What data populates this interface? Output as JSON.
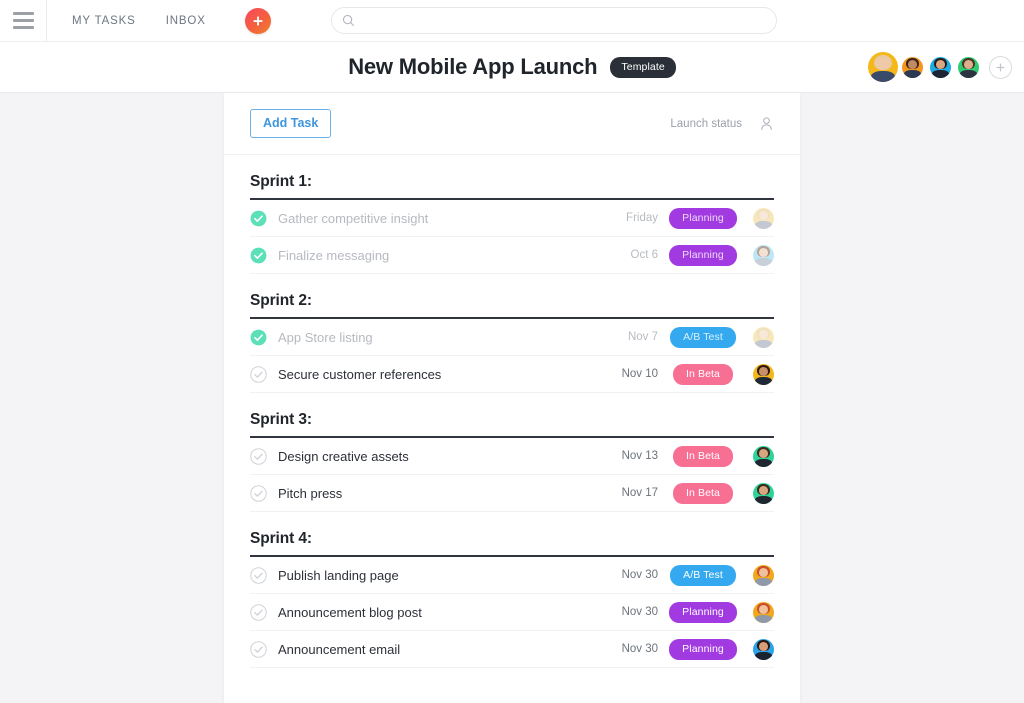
{
  "topnav": {
    "menu_icon": "hamburger-icon",
    "links": [
      {
        "label": "MY TASKS"
      },
      {
        "label": "INBOX"
      }
    ],
    "create_button_icon": "plus-icon",
    "search": {
      "icon": "search-icon",
      "value": "",
      "placeholder": ""
    }
  },
  "project_header": {
    "title": "New Mobile App Launch",
    "badge": "Template",
    "add_member_icon": "plus-icon",
    "members": [
      {
        "name": "member-1",
        "bg": "#f5b81a",
        "hair": "#e8c9a0",
        "skin": "#f0c9a8",
        "body": "#3a4a6b"
      },
      {
        "name": "member-2",
        "bg": "#f3961d",
        "hair": "#3b2419",
        "skin": "#c08a62",
        "body": "#2b3a52"
      },
      {
        "name": "member-3",
        "bg": "#1cabe3",
        "hair": "#2b1a14",
        "skin": "#d8a882",
        "body": "#1c2433"
      },
      {
        "name": "member-4",
        "bg": "#2ecb73",
        "hair": "#4a3527",
        "skin": "#dcae8c",
        "body": "#2d3440"
      }
    ]
  },
  "board": {
    "add_task_label": "Add Task",
    "launch_status_label": "Launch status",
    "assignee_header_icon": "person-icon",
    "sections": [
      {
        "title": "Sprint 1:",
        "tasks": [
          {
            "name": "Gather competitive insight",
            "date": "Friday",
            "tag": "Planning",
            "tag_color": "purple",
            "done": true,
            "avatar": {
              "bg": "#f1d27a",
              "hair": "#e5c27e",
              "skin": "#f3d2b6",
              "body": "#8892a8"
            }
          },
          {
            "name": "Finalize messaging",
            "date": "Oct 6",
            "tag": "Planning",
            "tag_color": "purple",
            "done": true,
            "avatar": {
              "bg": "#7fd0ef",
              "hair": "#6b4a38",
              "skin": "#e8c4a4",
              "body": "#93a0b5"
            }
          }
        ]
      },
      {
        "title": "Sprint 2:",
        "tasks": [
          {
            "name": "App Store listing",
            "date": "Nov 7",
            "tag": "A/B Test",
            "tag_color": "blue",
            "done": true,
            "avatar": {
              "bg": "#f1d27a",
              "hair": "#e5c27e",
              "skin": "#f3d2b6",
              "body": "#8892a8"
            }
          },
          {
            "name": "Secure customer references",
            "date": "Nov 10",
            "tag": "In Beta",
            "tag_color": "pink",
            "done": false,
            "avatar": {
              "bg": "#f3b61d",
              "hair": "#2e1a12",
              "skin": "#c98f66",
              "body": "#1f2836"
            }
          }
        ]
      },
      {
        "title": "Sprint 3:",
        "tasks": [
          {
            "name": "Design creative assets",
            "date": "Nov 13",
            "tag": "In Beta",
            "tag_color": "pink",
            "done": false,
            "avatar": {
              "bg": "#2fd39a",
              "hair": "#3b2a1e",
              "skin": "#d9a77f",
              "body": "#20262f"
            }
          },
          {
            "name": "Pitch press",
            "date": "Nov 17",
            "tag": "In Beta",
            "tag_color": "pink",
            "done": false,
            "avatar": {
              "bg": "#2fd39a",
              "hair": "#3b2a1e",
              "skin": "#d9a77f",
              "body": "#20262f"
            }
          }
        ]
      },
      {
        "title": "Sprint 4:",
        "tasks": [
          {
            "name": "Publish landing page",
            "date": "Nov 30",
            "tag": "A/B Test",
            "tag_color": "blue",
            "done": false,
            "avatar": {
              "bg": "#f0a81c",
              "hair": "#c94f2a",
              "skin": "#eec19b",
              "body": "#8f99a8"
            }
          },
          {
            "name": "Announcement blog post",
            "date": "Nov 30",
            "tag": "Planning",
            "tag_color": "purple",
            "done": false,
            "avatar": {
              "bg": "#f0a81c",
              "hair": "#c94f2a",
              "skin": "#eec19b",
              "body": "#8f99a8"
            }
          },
          {
            "name": "Announcement email",
            "date": "Nov 30",
            "tag": "Planning",
            "tag_color": "purple",
            "done": false,
            "avatar": {
              "bg": "#2ba3e8",
              "hair": "#2a1610",
              "skin": "#d79c78",
              "body": "#1b2230"
            }
          }
        ]
      }
    ]
  },
  "colors": {
    "accent_blue": "#3f96dd",
    "tag_purple": "#a13ae0",
    "tag_blue": "#34a9ef",
    "tag_pink": "#f76f93",
    "check_done": "#57e0b4",
    "page_bg": "#f4f4f6"
  }
}
